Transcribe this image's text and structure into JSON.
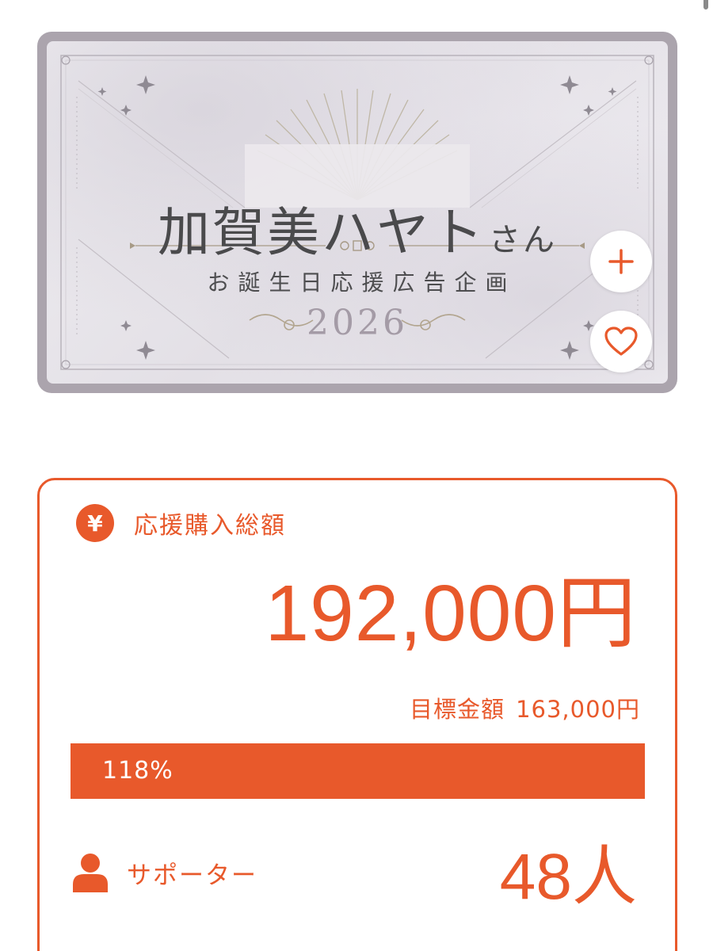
{
  "banner": {
    "name": "加賀美ハヤト",
    "honorific": "さん",
    "subtitle": "お誕生日応援広告企画",
    "year": "2026"
  },
  "actions": {
    "add_icon": "plus-icon",
    "favorite_icon": "heart-icon"
  },
  "stats": {
    "total_icon": "yen-icon",
    "total_icon_glyph": "¥",
    "total_label": "応援購入総額",
    "total_amount": "192,000円",
    "goal_label": "目標金額",
    "goal_amount": "163,000円",
    "progress_label": "118%",
    "progress_percent": 118,
    "supporters_icon": "person-icon",
    "supporters_label": "サポーター",
    "supporters_count": "48人"
  },
  "colors": {
    "accent": "#e8592b",
    "banner_frame": "#aba4ad",
    "banner_text": "#4a4a4c",
    "banner_year": "#a49ba6"
  }
}
